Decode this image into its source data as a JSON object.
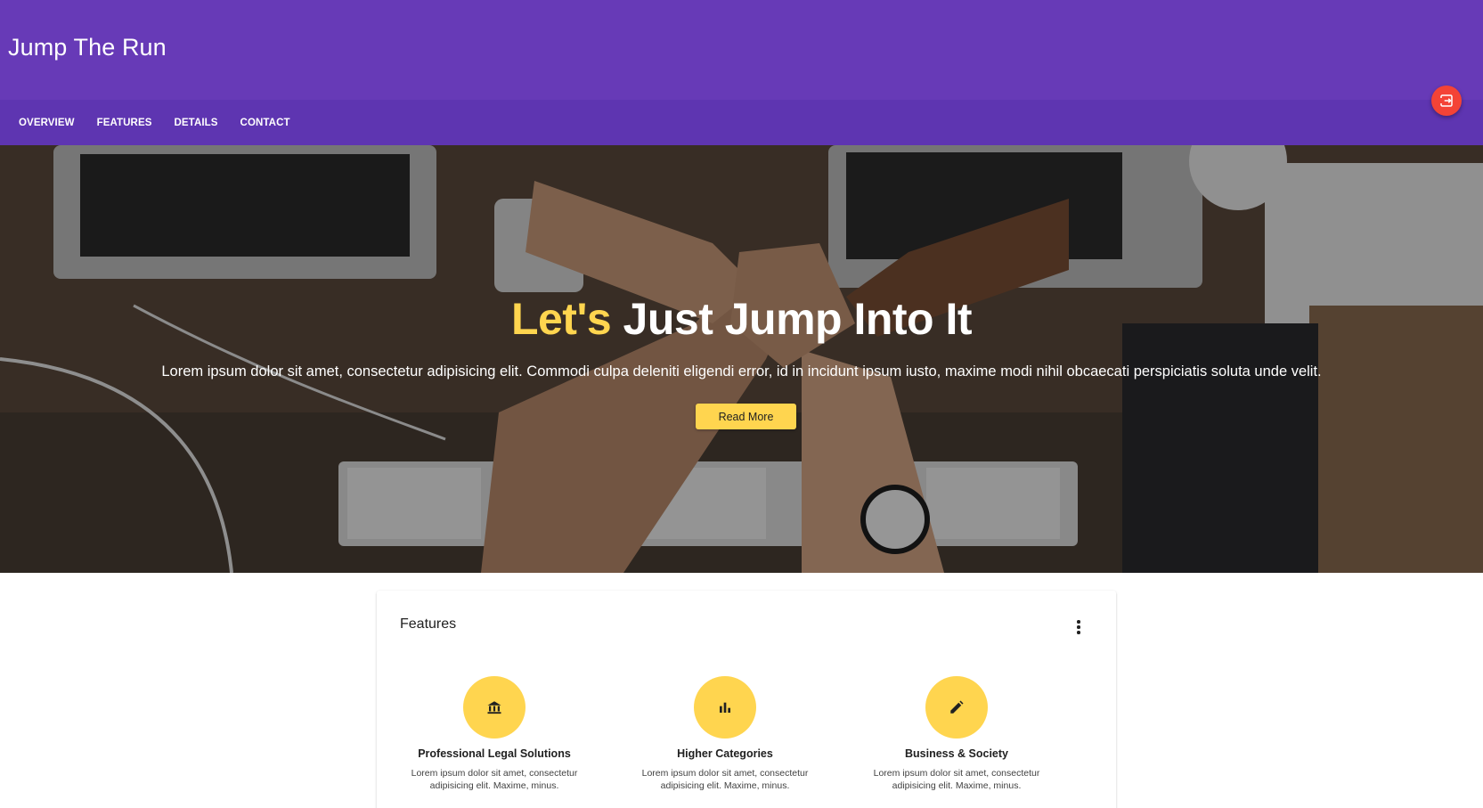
{
  "header": {
    "title": "Jump The Run",
    "background": "#673ab7",
    "nav_background": "#5e35b1",
    "nav": [
      {
        "label": "OVERVIEW"
      },
      {
        "label": "FEATURES"
      },
      {
        "label": "DETAILS"
      },
      {
        "label": "CONTACT"
      }
    ],
    "fab_icon": "exit-to-app-icon",
    "fab_color": "#f44336"
  },
  "hero": {
    "title_accent": "Let's",
    "title_rest": " Just Jump Into It",
    "text": "Lorem ipsum dolor sit amet, consectetur adipisicing elit. Commodi culpa deleniti eligendi error, id in incidunt ipsum iusto, maxime modi nihil obcaecati perspiciatis soluta unde velit.",
    "button_label": "Read More",
    "accent_color": "#ffd54f"
  },
  "features": {
    "title": "Features",
    "menu_icon": "more-vert-icon",
    "items": [
      {
        "icon": "bank-icon",
        "title": "Professional Legal Solutions",
        "text": "Lorem ipsum dolor sit amet, consectetur adipisicing elit. Maxime, minus."
      },
      {
        "icon": "bar-chart-icon",
        "title": "Higher Categories",
        "text": "Lorem ipsum dolor sit amet, consectetur adipisicing elit. Maxime, minus."
      },
      {
        "icon": "pencil-icon",
        "title": "Business & Society",
        "text": "Lorem ipsum dolor sit amet, consectetur adipisicing elit. Maxime, minus."
      }
    ]
  }
}
